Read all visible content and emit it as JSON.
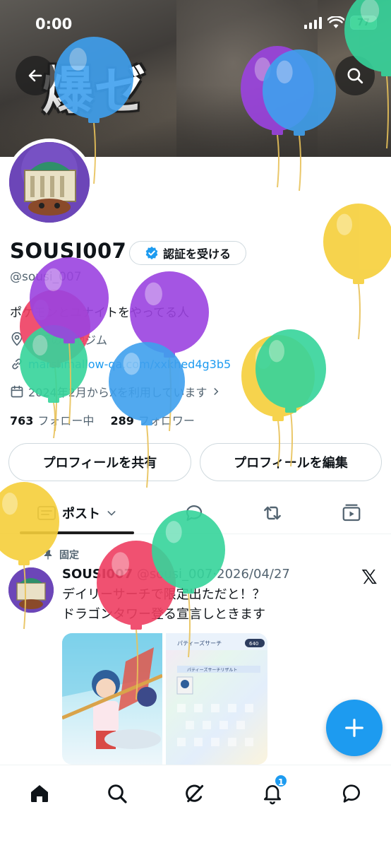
{
  "status_bar": {
    "time": "0:00",
    "battery": "77"
  },
  "banner": {
    "text": "爆ゼ"
  },
  "profile": {
    "name": "SOUSI007",
    "verify_label": "認証を受ける",
    "handle": "@sousi_007",
    "bio": "ポケモンとユナイトをやってる人",
    "location": "修行の聖地ジム",
    "website": "marshmallow-qa.com/xxkhed4g3b5",
    "joined": "2024年2月からXを利用しています",
    "following_count": "763",
    "following_label": "フォロー中",
    "followers_count": "289",
    "followers_label": "フォロワー",
    "share_label": "プロフィールを共有",
    "edit_label": "プロフィールを編集"
  },
  "tabs": {
    "posts_label": "ポスト"
  },
  "post": {
    "pinned_label": "固定",
    "author": "SOUSI007",
    "handle": "@sousi_007",
    "date": "·2026/04/27",
    "text": "デイリーサーチで限定出ただと！？\nドラゴンタワー登る宣言しときます",
    "image2_title": "パティーズサーチ",
    "image2_badge": "640",
    "image2_sub": "パティーズサーチリザルト"
  },
  "nav": {
    "notifications_badge": "1"
  },
  "colors": {
    "accent": "#1d9bf0",
    "balloon_blue": "#3fa0ee",
    "balloon_purple": "#9b43e0",
    "balloon_green": "#36d49b",
    "balloon_yellow": "#f6cf3a",
    "balloon_red": "#ef3f62"
  },
  "icons": [
    "back-arrow-icon",
    "search-icon",
    "verified-badge-icon",
    "location-icon",
    "link-icon",
    "calendar-icon",
    "chevron-right-icon",
    "chevron-down-icon",
    "list-icon",
    "reply-icon",
    "repost-icon",
    "media-icon",
    "pin-icon",
    "x-logo-icon",
    "plus-icon",
    "home-icon",
    "grok-icon",
    "bell-icon",
    "messages-icon"
  ]
}
